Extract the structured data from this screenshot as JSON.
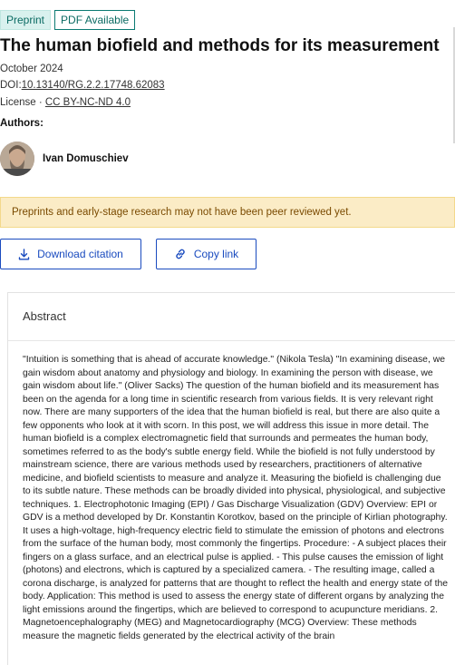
{
  "badges": {
    "preprint": "Preprint",
    "pdf": "PDF Available"
  },
  "title": "The human biofield and methods for its measurement",
  "date": "October 2024",
  "doi": {
    "label": "DOI:",
    "value": "10.13140/RG.2.2.17748.62083"
  },
  "license": {
    "label": "License · ",
    "value": "CC BY-NC-ND 4.0"
  },
  "authors_label": "Authors:",
  "author": {
    "name": "Ivan Domuschiev"
  },
  "warning": "Preprints and early-stage research may not have been peer reviewed yet.",
  "buttons": {
    "download_citation": "Download citation",
    "copy_link": "Copy link"
  },
  "abstract": {
    "heading": "Abstract",
    "text": "\"Intuition is something that is ahead of accurate knowledge.\" (Nikola Tesla) \"In examining disease, we gain wisdom about anatomy and physiology and biology. In examining the person with disease, we gain wisdom about life.\" (Oliver Sacks) The question of the human biofield and its measurement has been on the agenda for a long time in scientific research from various fields. It is very relevant right now. There are many supporters of the idea that the human biofield is real, but there are also quite a few opponents who look at it with scorn. In this post, we will address this issue in more detail. The human biofield is a complex electromagnetic field that surrounds and permeates the human body, sometimes referred to as the body's subtle energy field. While the biofield is not fully understood by mainstream science, there are various methods used by researchers, practitioners of alternative medicine, and biofield scientists to measure and analyze it. Measuring the biofield is challenging due to its subtle nature. These methods can be broadly divided into physical, physiological, and subjective techniques. 1. Electrophotonic Imaging (EPI) / Gas Discharge Visualization (GDV) Overview: EPI or GDV is a method developed by Dr. Konstantin Korotkov, based on the principle of Kirlian photography. It uses a high-voltage, high-frequency electric field to stimulate the emission of photons and electrons from the surface of the human body, most commonly the fingertips. Procedure: - A subject places their fingers on a glass surface, and an electrical pulse is applied. - This pulse causes the emission of light (photons) and electrons, which is captured by a specialized camera. - The resulting image, called a corona discharge, is analyzed for patterns that are thought to reflect the health and energy state of the body. Application: This method is used to assess the energy state of different organs by analyzing the light emissions around the fingertips, which are believed to correspond to acupuncture meridians. 2. Magnetoencephalography (MEG) and Magnetocardiography (MCG) Overview: These methods measure the magnetic fields generated by the electrical activity of the brain"
  },
  "colors": {
    "accent": "#1a4bbf",
    "badge": "#0b7a72",
    "warning_bg": "#fbecc6",
    "warning_text": "#7a4a00"
  },
  "icons": {
    "download": "download-icon",
    "link": "link-icon"
  }
}
